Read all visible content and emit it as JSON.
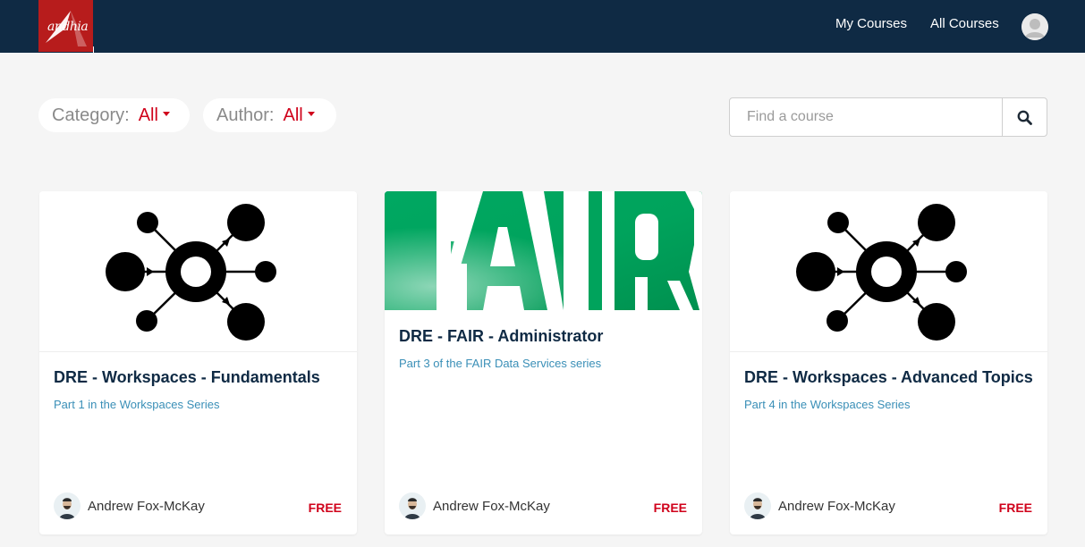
{
  "header": {
    "logo_text": "andhia",
    "nav": {
      "my_courses": "My Courses",
      "all_courses": "All Courses"
    }
  },
  "filters": {
    "category": {
      "label": "Category:",
      "value": "All"
    },
    "author": {
      "label": "Author:",
      "value": "All"
    }
  },
  "search": {
    "placeholder": "Find a course"
  },
  "courses": [
    {
      "title": "DRE - Workspaces - Fundamentals",
      "subtitle": "Part 1 in the Workspaces Series",
      "author": "Andrew Fox-McKay",
      "price": "FREE",
      "image_icon": "network-hub-icon"
    },
    {
      "title": "DRE - FAIR - Administrator",
      "subtitle": "Part 3 of the FAIR Data Services series",
      "author": "Andrew Fox-McKay",
      "price": "FREE",
      "image_icon": "fair-logo",
      "image_text": "FAIR"
    },
    {
      "title": "DRE - Workspaces - Advanced Topics",
      "subtitle": "Part 4 in the Workspaces Series",
      "author": "Andrew Fox-McKay",
      "price": "FREE",
      "image_icon": "network-hub-icon"
    }
  ],
  "colors": {
    "nav_bg": "#0f2a44",
    "logo_bg": "#b71c1c",
    "accent_red": "#d0021b",
    "link_blue": "#3a8fb7",
    "fair_green": "#00a05a"
  }
}
